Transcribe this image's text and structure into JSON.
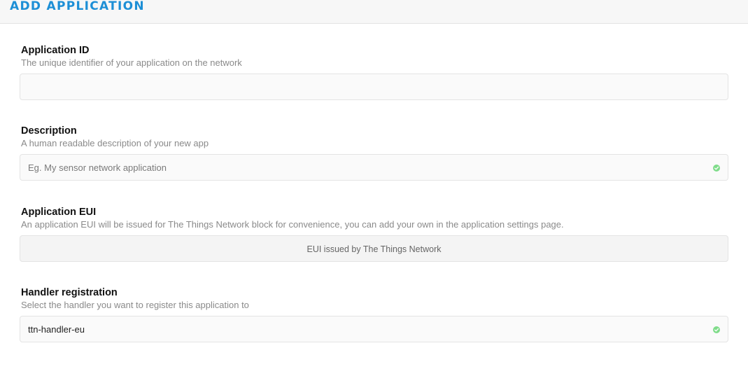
{
  "header": {
    "title": "ADD APPLICATION"
  },
  "fields": {
    "app_id": {
      "label": "Application ID",
      "hint": "The unique identifier of your application on the network",
      "value": ""
    },
    "description": {
      "label": "Description",
      "hint": "A human readable description of your new app",
      "placeholder": "Eg. My sensor network application",
      "status_icon": "check-circle-icon"
    },
    "app_eui": {
      "label": "Application EUI",
      "hint": "An application EUI will be issued for The Things Network block for convenience, you can add your own in the application settings page.",
      "value": "EUI issued by The Things Network"
    },
    "handler": {
      "label": "Handler registration",
      "hint": "Select the handler you want to register this application to",
      "value": "ttn-handler-eu",
      "status_icon": "check-circle-icon"
    }
  },
  "colors": {
    "accent": "#1d8fd6",
    "valid": "#7fdc8a"
  }
}
